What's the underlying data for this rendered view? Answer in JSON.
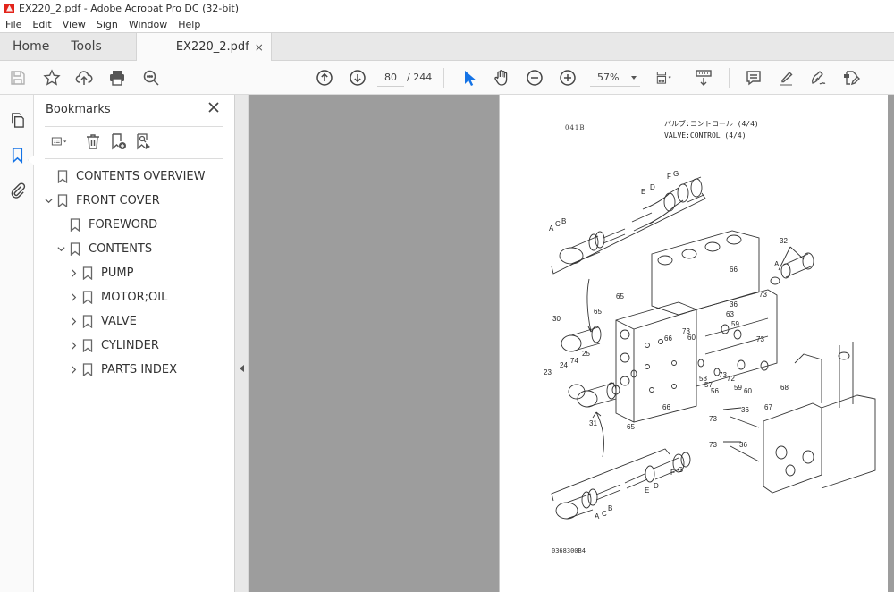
{
  "window": {
    "title": "EX220_2.pdf - Adobe Acrobat Pro DC (32-bit)",
    "app_icon": "acrobat-icon"
  },
  "menu": [
    "File",
    "Edit",
    "View",
    "Sign",
    "Window",
    "Help"
  ],
  "tabs": {
    "home": "Home",
    "tools": "Tools",
    "document": "EX220_2.pdf",
    "close_glyph": "×"
  },
  "toolbar": {
    "left_icons": [
      "save-icon",
      "bookmark-star-icon",
      "cloud-upload-icon",
      "print-icon",
      "find-icon"
    ],
    "current_page": "80",
    "total_pages": "/ 244",
    "zoom": "57%",
    "nav_icons": [
      "previous-page-icon",
      "next-page-icon"
    ],
    "tool_icons": [
      "select-pointer-icon",
      "hand-icon",
      "zoom-out-icon",
      "zoom-in-icon"
    ],
    "right_icons": [
      "page-fit-icon",
      "scroll-mode-icon",
      "comment-icon",
      "highlight-icon",
      "sign-icon",
      "edit-pdf-icon"
    ],
    "accent": "#1473e6"
  },
  "left_rail": [
    "page-thumbnails-icon",
    "bookmarks-icon",
    "attachments-icon"
  ],
  "bookmarks": {
    "title": "Bookmarks",
    "tools": [
      "options-menu-icon",
      "delete-bookmark-icon",
      "new-bookmark-icon",
      "bookmark-search-icon"
    ],
    "items": [
      {
        "label": "CONTENTS OVERVIEW",
        "level": 0,
        "expander": "none"
      },
      {
        "label": "FRONT COVER",
        "level": 0,
        "expander": "expanded"
      },
      {
        "label": "FOREWORD",
        "level": 1,
        "expander": "none"
      },
      {
        "label": "CONTENTS",
        "level": 1,
        "expander": "expanded"
      },
      {
        "label": "PUMP",
        "level": 2,
        "expander": "collapsed"
      },
      {
        "label": "MOTOR;OIL",
        "level": 2,
        "expander": "collapsed"
      },
      {
        "label": "VALVE",
        "level": 2,
        "expander": "collapsed"
      },
      {
        "label": "CYLINDER",
        "level": 2,
        "expander": "collapsed"
      },
      {
        "label": "PARTS INDEX",
        "level": 2,
        "expander": "collapsed"
      }
    ]
  },
  "page": {
    "code": "041B",
    "title_jp": "バルブ:コントロール (4/4)",
    "title_en": "VALVE:CONTROL (4/4)",
    "footer": "0368300B4",
    "callouts": {
      "top_spool": [
        "A",
        "C",
        "B",
        "E",
        "D",
        "F",
        "G"
      ],
      "bottom_spool": [
        "A",
        "C",
        "B",
        "E",
        "D",
        "F",
        "G"
      ],
      "left": [
        "30",
        "65",
        "65",
        "23",
        "24",
        "74",
        "25",
        "31",
        "65",
        "66",
        "66"
      ],
      "right": [
        "32",
        "A",
        "66",
        "73",
        "36",
        "63",
        "59",
        "73",
        "60",
        "73",
        "73",
        "72",
        "59",
        "60",
        "58",
        "57",
        "56",
        "68",
        "67",
        "36",
        "73",
        "36",
        "73"
      ]
    }
  }
}
